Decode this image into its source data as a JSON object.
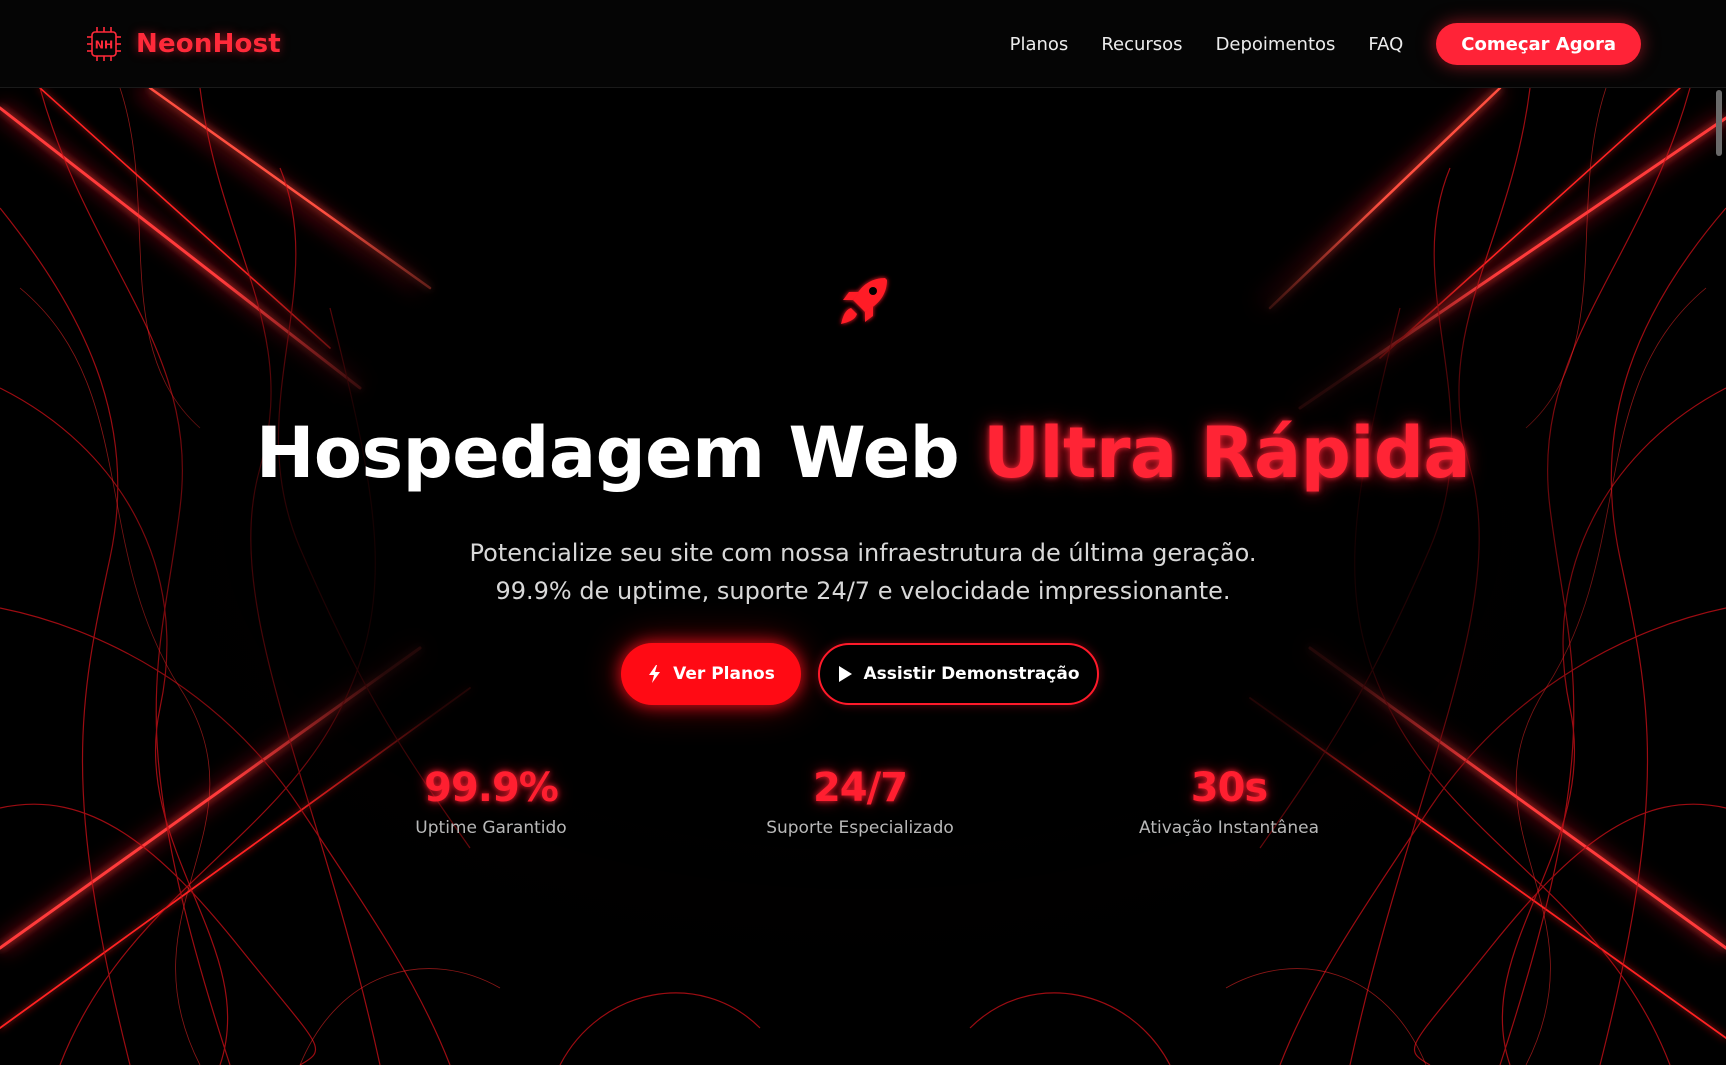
{
  "brand": {
    "logo_letters": "NH",
    "name": "NeonHost"
  },
  "nav": {
    "links": [
      {
        "label": "Planos"
      },
      {
        "label": "Recursos"
      },
      {
        "label": "Depoimentos"
      },
      {
        "label": "FAQ"
      }
    ],
    "cta_label": "Começar Agora"
  },
  "hero": {
    "icon": "rocket-icon",
    "title_main": "Hospedagem Web ",
    "title_accent": "Ultra Rápida",
    "subtitle_line1": "Potencialize seu site com nossa infraestrutura de última geração.",
    "subtitle_line2": "99.9% de uptime, suporte 24/7 e velocidade impressionante.",
    "primary_button": {
      "label": "Ver Planos",
      "icon": "bolt-icon"
    },
    "secondary_button": {
      "label": "Assistir Demonstração",
      "icon": "play-icon"
    },
    "stats": [
      {
        "value": "99.9%",
        "label": "Uptime Garantido"
      },
      {
        "value": "24/7",
        "label": "Suporte Especializado"
      },
      {
        "value": "30s",
        "label": "Ativação Instantânea"
      }
    ]
  },
  "colors": {
    "accent": "#ff2337",
    "neon_red": "#ff0a14",
    "background": "#000000",
    "text_muted": "#b8b8b8"
  }
}
